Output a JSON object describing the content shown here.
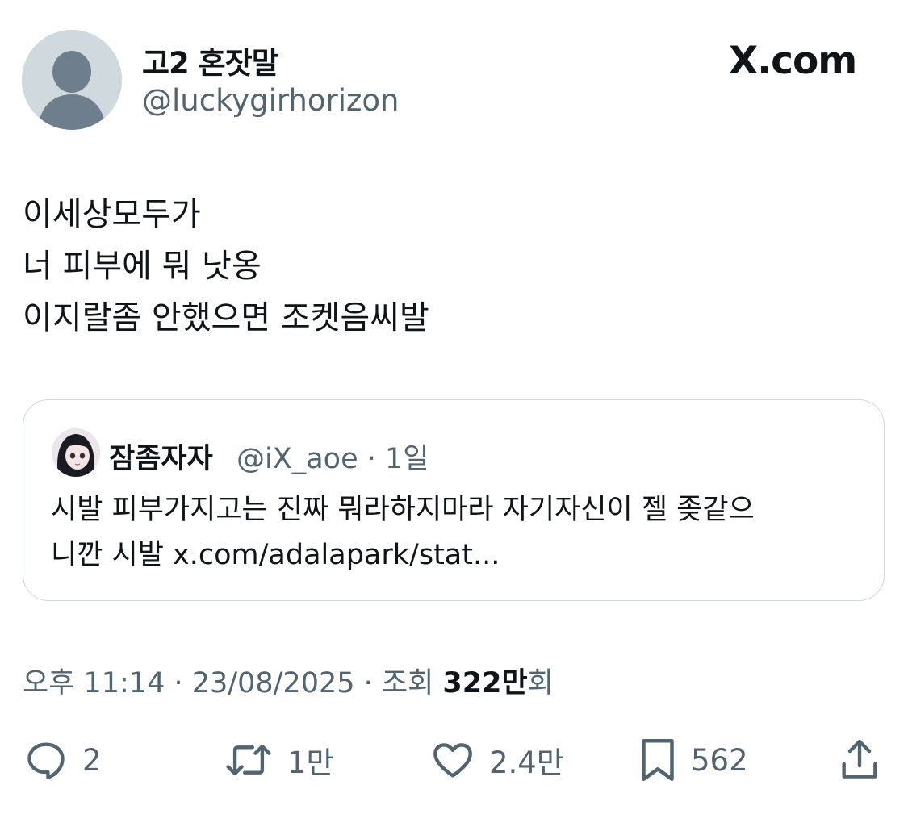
{
  "author": {
    "display_name": "고2 혼잣말",
    "handle": "@luckygirhorizon"
  },
  "brand": {
    "logo_text": "X.com"
  },
  "tweet": {
    "lines": [
      "이세상모두가",
      "너 피부에 뭐 낫옹",
      "이지랄좀 안했으면 조켓음씨발"
    ]
  },
  "quote": {
    "display_name": "잠좀자자",
    "meta": "@iX_aoe · 1일",
    "lines": [
      "시발 피부가지고는 진짜 뭐라하지마라 자기자신이 젤 좆같으",
      "니깐 시발 x.com/adalapark/stat..."
    ]
  },
  "meta": {
    "prefix": "오후 11:14 · 23/08/2025 · 조회 ",
    "views": "322만",
    "suffix": "회"
  },
  "actions": {
    "reply_count": "2",
    "retweet_count": "1만",
    "like_count": "2.4만",
    "bookmark_count": "562",
    "reply_icon": "speech-bubble",
    "retweet_icon": "retweet-arrows",
    "like_icon": "heart",
    "bookmark_icon": "bookmark",
    "share_icon": "share-upload"
  },
  "colors": {
    "text_primary": "#0f1419",
    "text_secondary": "#536471",
    "border": "#cfd9de",
    "default_avatar_bg": "#cfd9de",
    "default_avatar_figure": "#6e7e8c"
  }
}
